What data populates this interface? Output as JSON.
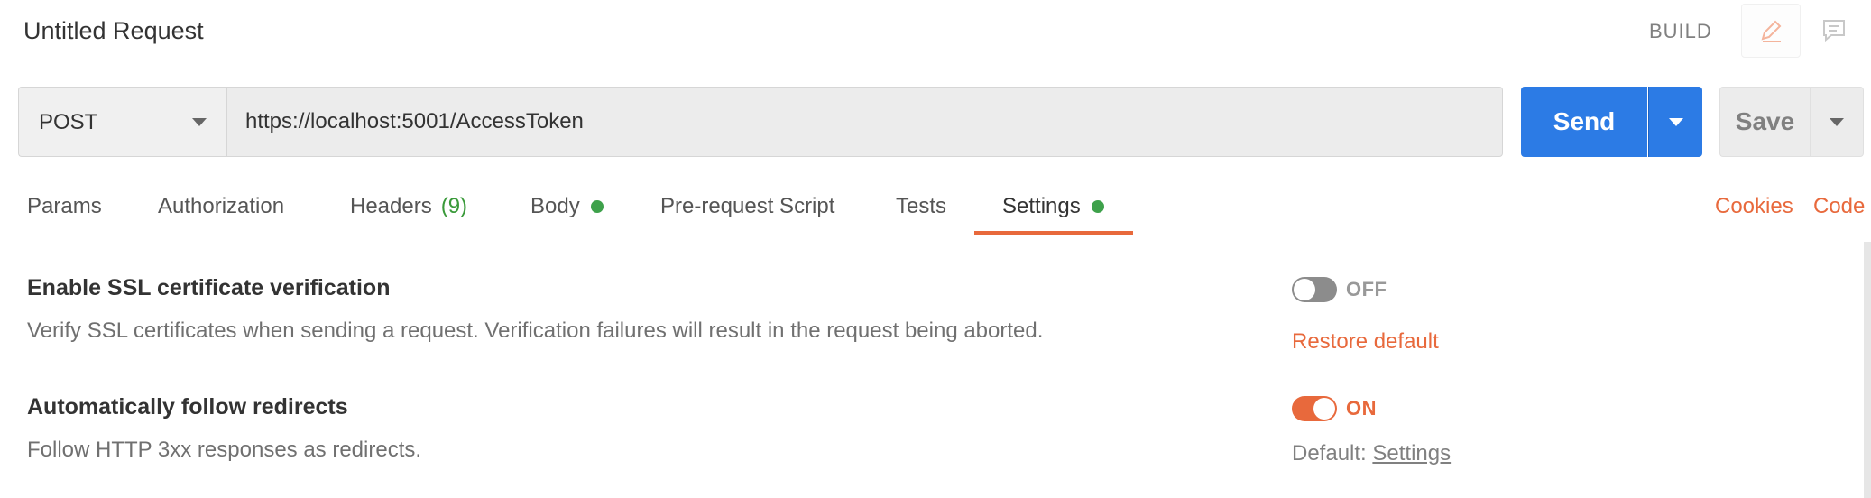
{
  "header": {
    "title": "Untitled Request",
    "build_label": "BUILD",
    "icons": [
      "pencil-icon",
      "comment-icon"
    ]
  },
  "request": {
    "method": "POST",
    "url": "https://localhost:5001/AccessToken",
    "send_label": "Send",
    "save_label": "Save"
  },
  "tabs": [
    {
      "label": "Params"
    },
    {
      "label": "Authorization"
    },
    {
      "label": "Headers",
      "count": "(9)"
    },
    {
      "label": "Body",
      "indicator": true
    },
    {
      "label": "Pre-request Script"
    },
    {
      "label": "Tests"
    },
    {
      "label": "Settings",
      "indicator": true,
      "active": true
    }
  ],
  "links": {
    "cookies": "Cookies",
    "code": "Code"
  },
  "settings": [
    {
      "title": "Enable SSL certificate verification",
      "description": "Verify SSL certificates when sending a request. Verification failures will result in the request being aborted.",
      "state": "OFF",
      "action": "Restore default"
    },
    {
      "title": "Automatically follow redirects",
      "description": "Follow HTTP 3xx responses as redirects.",
      "state": "ON",
      "default_prefix": "Default:",
      "default_link": "Settings"
    }
  ],
  "colors": {
    "accent": "#e8693c",
    "send_blue": "#2c7be5",
    "indicator_green": "#3ea14b"
  }
}
